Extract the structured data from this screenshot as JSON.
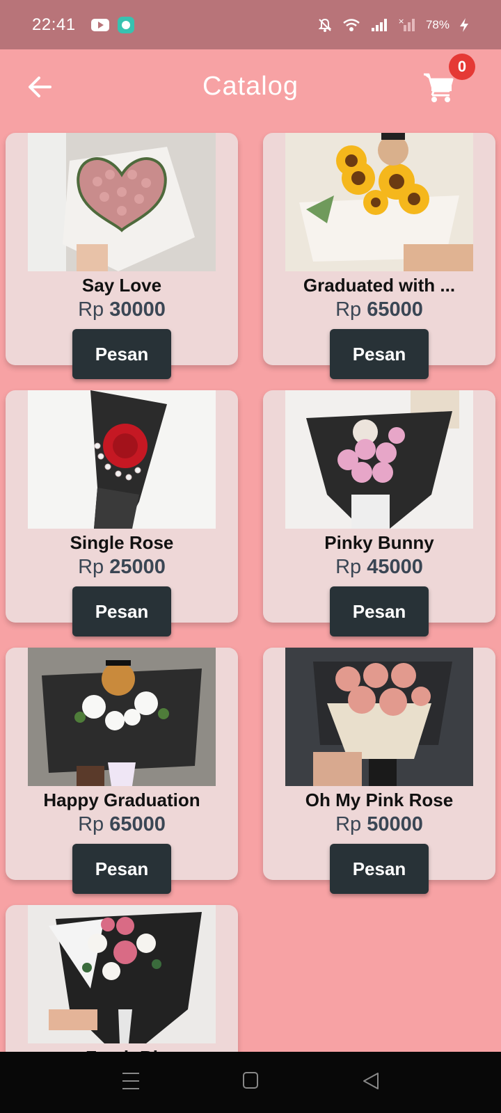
{
  "status_bar": {
    "time": "22:41",
    "battery": "78%",
    "icons": [
      "youtube-icon",
      "chat-app-icon",
      "bell-muted-icon",
      "wifi-icon",
      "signal-icon",
      "signal-x-icon",
      "charging-icon"
    ]
  },
  "app_bar": {
    "title": "Catalog",
    "back_icon": "arrow-left-icon",
    "cart_icon": "cart-icon",
    "cart_count": "0"
  },
  "products": [
    {
      "name": "Say Love",
      "currency": "Rp",
      "price": "30000",
      "button": "Pesan"
    },
    {
      "name": "Graduated with ...",
      "currency": "Rp",
      "price": "65000",
      "button": "Pesan"
    },
    {
      "name": "Single Rose",
      "currency": "Rp",
      "price": "25000",
      "button": "Pesan"
    },
    {
      "name": "Pinky Bunny",
      "currency": "Rp",
      "price": "45000",
      "button": "Pesan"
    },
    {
      "name": "Happy Graduation",
      "currency": "Rp",
      "price": "65000",
      "button": "Pesan"
    },
    {
      "name": "Oh My Pink Rose",
      "currency": "Rp",
      "price": "50000",
      "button": "Pesan"
    },
    {
      "name": "Fresh Bl",
      "currency": "",
      "price": "",
      "button": ""
    }
  ],
  "nav_bar": {
    "icons": [
      "menu-icon",
      "home-square-icon",
      "back-triangle-icon"
    ]
  },
  "colors": {
    "background": "#f7a2a4",
    "status_bar": "#b87479",
    "card": "#eed7d7",
    "button": "#283237",
    "badge": "#e53935"
  }
}
